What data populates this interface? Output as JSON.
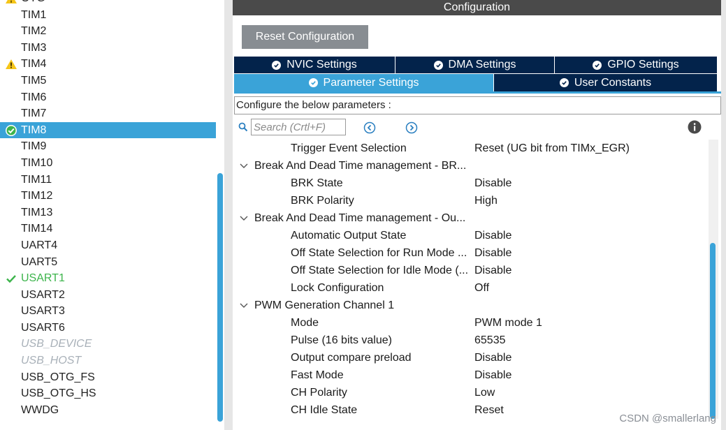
{
  "left_list": [
    {
      "label": "OTG",
      "state": "warning"
    },
    {
      "label": "TIM1",
      "state": "normal"
    },
    {
      "label": "TIM2",
      "state": "normal"
    },
    {
      "label": "TIM3",
      "state": "normal"
    },
    {
      "label": "TIM4",
      "state": "warning"
    },
    {
      "label": "TIM5",
      "state": "normal"
    },
    {
      "label": "TIM6",
      "state": "normal"
    },
    {
      "label": "TIM7",
      "state": "normal"
    },
    {
      "label": "TIM8",
      "state": "selected"
    },
    {
      "label": "TIM9",
      "state": "normal"
    },
    {
      "label": "TIM10",
      "state": "normal"
    },
    {
      "label": "TIM11",
      "state": "normal"
    },
    {
      "label": "TIM12",
      "state": "normal"
    },
    {
      "label": "TIM13",
      "state": "normal"
    },
    {
      "label": "TIM14",
      "state": "normal"
    },
    {
      "label": "UART4",
      "state": "normal"
    },
    {
      "label": "UART5",
      "state": "normal"
    },
    {
      "label": "USART1",
      "state": "ok"
    },
    {
      "label": "USART2",
      "state": "normal"
    },
    {
      "label": "USART3",
      "state": "normal"
    },
    {
      "label": "USART6",
      "state": "normal"
    },
    {
      "label": "USB_DEVICE",
      "state": "disabled"
    },
    {
      "label": "USB_HOST",
      "state": "disabled"
    },
    {
      "label": "USB_OTG_FS",
      "state": "normal"
    },
    {
      "label": "USB_OTG_HS",
      "state": "normal"
    },
    {
      "label": "WWDG",
      "state": "normal"
    }
  ],
  "config": {
    "title": "Configuration",
    "reset_label": "Reset Configuration",
    "tabs": {
      "nvic": "NVIC Settings",
      "dma": "DMA Settings",
      "gpio": "GPIO Settings",
      "parameter": "Parameter Settings",
      "user_constants": "User Constants"
    },
    "configure_text": "Configure the below parameters :",
    "search_placeholder": "Search (Crtl+F)"
  },
  "params": [
    {
      "kind": "param",
      "name": "Trigger Event Selection",
      "value": "Reset (UG bit from TIMx_EGR)"
    },
    {
      "kind": "group",
      "name": "Break And Dead Time management - BR..."
    },
    {
      "kind": "param",
      "name": "BRK State",
      "value": "Disable"
    },
    {
      "kind": "param",
      "name": "BRK Polarity",
      "value": "High"
    },
    {
      "kind": "group",
      "name": "Break And Dead Time management - Ou..."
    },
    {
      "kind": "param",
      "name": "Automatic Output State",
      "value": "Disable"
    },
    {
      "kind": "param",
      "name": "Off State Selection for Run Mode ...",
      "value": "Disable"
    },
    {
      "kind": "param",
      "name": "Off State Selection for Idle Mode (...",
      "value": "Disable"
    },
    {
      "kind": "param",
      "name": "Lock Configuration",
      "value": "Off"
    },
    {
      "kind": "group",
      "name": "PWM Generation Channel 1"
    },
    {
      "kind": "param",
      "name": "Mode",
      "value": "PWM mode 1"
    },
    {
      "kind": "param",
      "name": "Pulse (16 bits value)",
      "value": "65535"
    },
    {
      "kind": "param",
      "name": "Output compare preload",
      "value": "Disable"
    },
    {
      "kind": "param",
      "name": "Fast Mode",
      "value": "Disable"
    },
    {
      "kind": "param",
      "name": "CH Polarity",
      "value": "Low"
    },
    {
      "kind": "param",
      "name": "CH Idle State",
      "value": "Reset"
    }
  ],
  "watermark": "CSDN @smallerlang",
  "colors": {
    "accent": "#3aa3d8",
    "tab_dark": "#03234b",
    "ok_green": "#3cb44b",
    "warning_yellow": "#f5c518",
    "header_bg": "#4a4a4a"
  }
}
